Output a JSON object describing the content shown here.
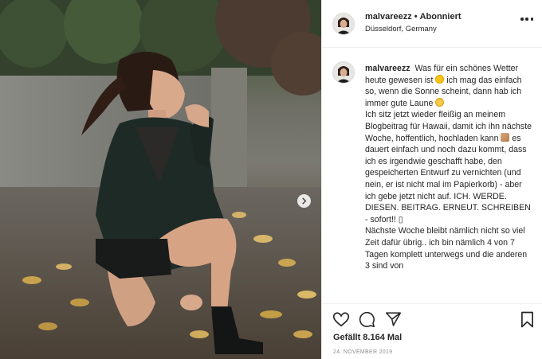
{
  "post": {
    "username": "malvareezz",
    "follow_status": "Abonniert",
    "separator": "•",
    "location": "Düsseldorf, Germany",
    "caption_user": "malvareezz",
    "caption_lines": [
      "Was für ein schönes Wetter heute gewesen ist",
      "ich mag das einfach so, wenn die Sonne scheint, dann hab ich immer gute Laune",
      "Ich sitz jetzt wieder fleißig an meinem Blogbeitrag für Hawaii, damit ich ihn nächste Woche, hoffentlich, hochladen kann",
      "es dauert einfach und noch dazu kommt, dass ich es irgendwie geschafft habe, den gespeicherten Entwurf zu vernichten (und nein, er ist nicht mal im Papierkorb) - aber ich gebe jetzt nicht auf. ICH. WERDE. DIESEN. BEITRAG. ERNEUT. SCHREIBEN - sofort!! ",
      "Nächste Woche bleibt nämlich nicht so viel Zeit dafür übrig.. ich bin nämlich 4 von 7 Tagen komplett unterwegs und die anderen 3 sind von"
    ],
    "likes": "Gefällt 8.164 Mal",
    "date": "24. NOVEMBER 2019",
    "missing_glyph": "▯"
  },
  "icons": {
    "more": "more-options-icon",
    "like": "heart-icon",
    "comment": "comment-icon",
    "share": "paper-plane-icon",
    "save": "bookmark-icon",
    "next": "chevron-right-icon"
  },
  "colors": {
    "text": "#262626",
    "muted": "#8e8e8e",
    "border": "#efefef",
    "sun_emoji": "#f5c518"
  }
}
